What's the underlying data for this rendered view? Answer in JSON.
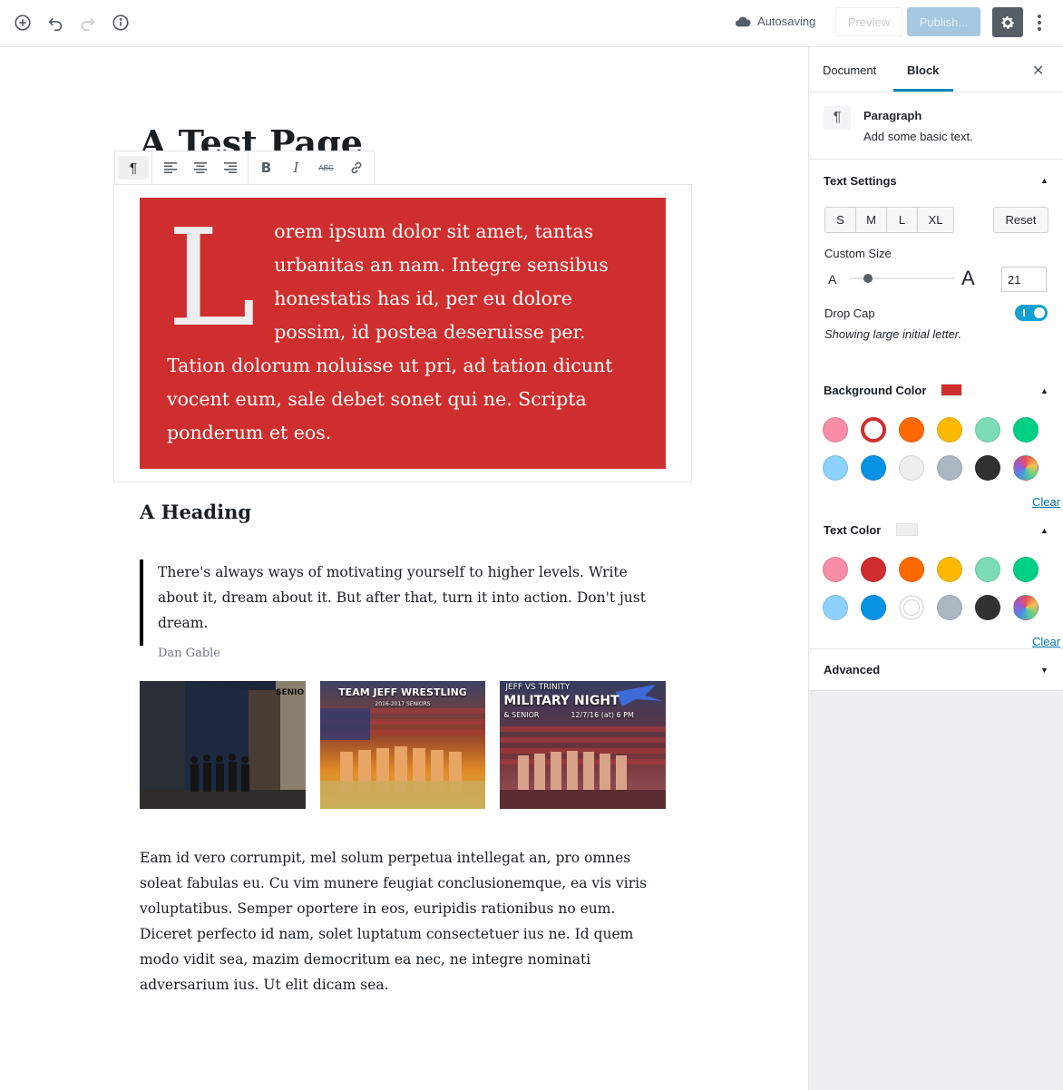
{
  "topbar": {
    "autosave_label": "Autosaving",
    "preview_label": "Preview",
    "publish_label": "Publish..."
  },
  "post": {
    "title": "A Test Page",
    "dropcap_letter": "L",
    "paragraph1": "orem ipsum dolor sit amet, tantas urbanitas an nam. Integre sensibus honestatis has id, per eu dolore possim, id postea deseruisse per. Tation dolorum noluisse ut pri, ad tation dicunt vocent eum, sale debet sonet qui ne. Scripta ponderum et eos.",
    "paragraph1_bg": "#cf2e2e",
    "heading": "A Heading",
    "quote_text": "There's always ways of motivating yourself to higher levels. Write about it, dream about it. But after that, turn it into action. Don't just dream.",
    "quote_cite": "Dan Gable",
    "gallery": [
      {
        "caption_line1": "SENIO",
        "caption_line2": ""
      },
      {
        "caption_line1": "TEAM JEFF WRESTLING",
        "caption_line2": "2016-2017 SENIORS"
      },
      {
        "caption_line1": "JEFF VS TRINITY",
        "caption_line2": "MILITARY NIGHT",
        "caption_line3": "& SENIOR",
        "caption_line4": "12/7/16 (at) 6 PM"
      }
    ],
    "paragraph2": "Eam id vero corrumpit, mel solum perpetua intellegat an, pro omnes soleat fabulas eu. Cu vim munere feugiat conclusionemque, ea vis viris voluptatibus. Semper oportere in eos, euripidis rationibus no eum. Diceret perfecto id nam, solet luptatum consectetuer ius ne. Id quem modo vidit sea, mazim democritum ea nec, ne integre nominati adversarium ius. Ut elit dicam sea."
  },
  "sidebar": {
    "tabs": [
      {
        "label": "Document"
      },
      {
        "label": "Block"
      }
    ],
    "block_title": "Paragraph",
    "block_desc": "Add some basic text.",
    "text_settings": {
      "title": "Text Settings",
      "sizes": [
        "S",
        "M",
        "L",
        "XL"
      ],
      "reset_label": "Reset",
      "custom_size_label": "Custom Size",
      "small_a": "A",
      "large_a": "A",
      "custom_size_value": "21",
      "drop_cap_label": "Drop Cap",
      "drop_cap_help": "Showing large initial letter."
    },
    "background_color": {
      "title": "Background Color",
      "current": "#cf2e2e",
      "clear_label": "Clear",
      "swatches": [
        "#f78da7",
        "#cf2e2e",
        "#ff6900",
        "#fcb900",
        "#7bdcb5",
        "#00d084",
        "#8ed1fc",
        "#0693e3",
        "#eeeeee",
        "#abb8c3",
        "#313131",
        "multicolor"
      ]
    },
    "text_color": {
      "title": "Text Color",
      "current": "#eeeeee",
      "clear_label": "Clear",
      "swatches": [
        "#f78da7",
        "#cf2e2e",
        "#ff6900",
        "#fcb900",
        "#7bdcb5",
        "#00d084",
        "#8ed1fc",
        "#0693e3",
        "#ffffff",
        "#abb8c3",
        "#313131",
        "multicolor"
      ]
    },
    "advanced": {
      "title": "Advanced"
    }
  }
}
